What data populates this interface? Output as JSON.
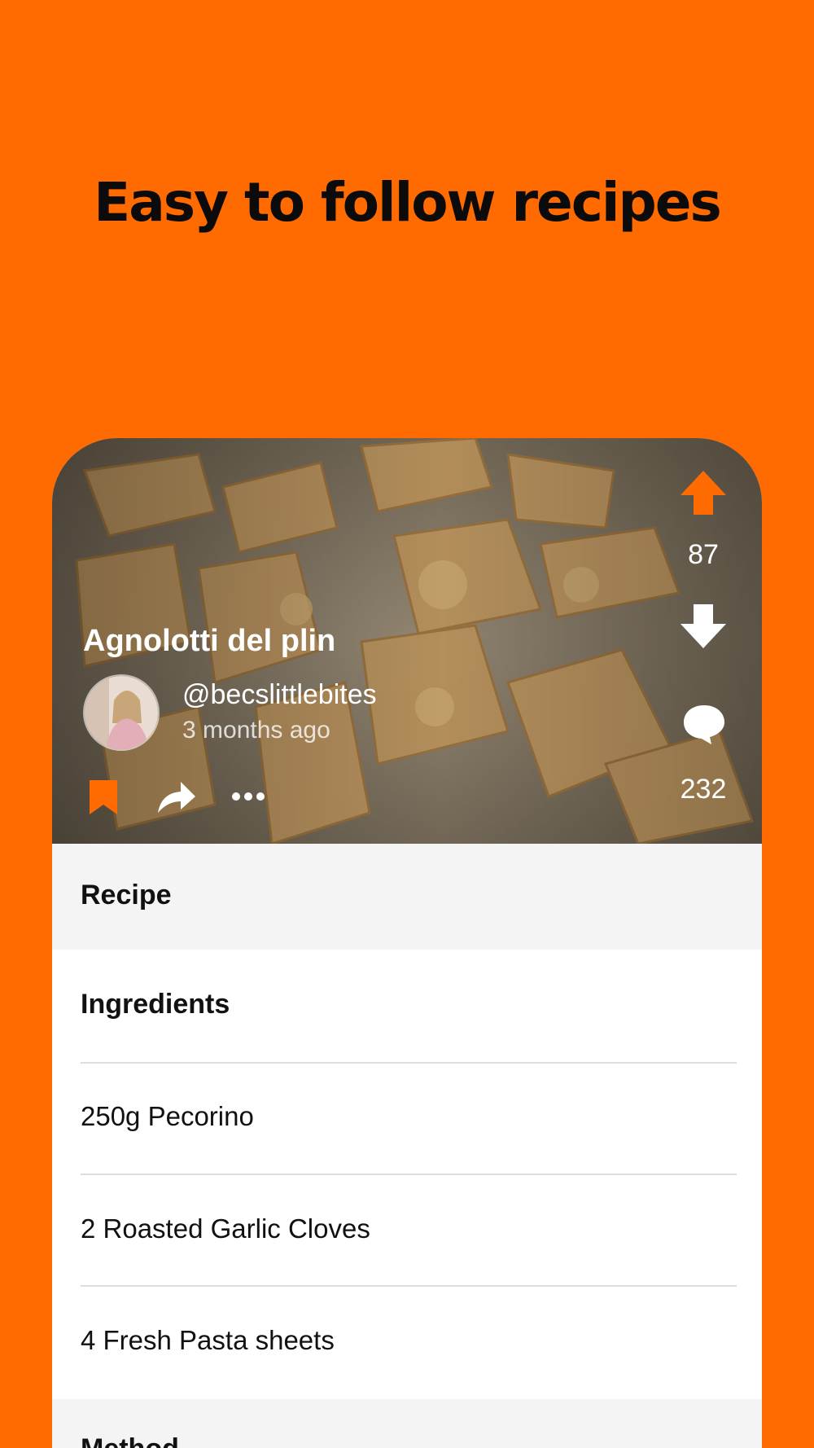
{
  "headline": "Easy to follow recipes",
  "post": {
    "title": "Agnolotti del plin",
    "author_handle": "@becslittlebites",
    "posted_time": "3 months ago",
    "vote_count": "87",
    "comment_count": "232"
  },
  "recipe": {
    "section_label": "Recipe",
    "ingredients_label": "Ingredients",
    "ingredients": [
      "250g Pecorino",
      "2 Roasted Garlic Cloves",
      "4 Fresh Pasta sheets"
    ],
    "method_label": "Method"
  },
  "colors": {
    "accent": "#FF6B00",
    "section_bg": "#F4F4F4",
    "divider": "#DDDDDD"
  },
  "icons": [
    "bookmark-icon",
    "share-icon",
    "more-icon",
    "upvote-icon",
    "downvote-icon",
    "comment-icon"
  ]
}
